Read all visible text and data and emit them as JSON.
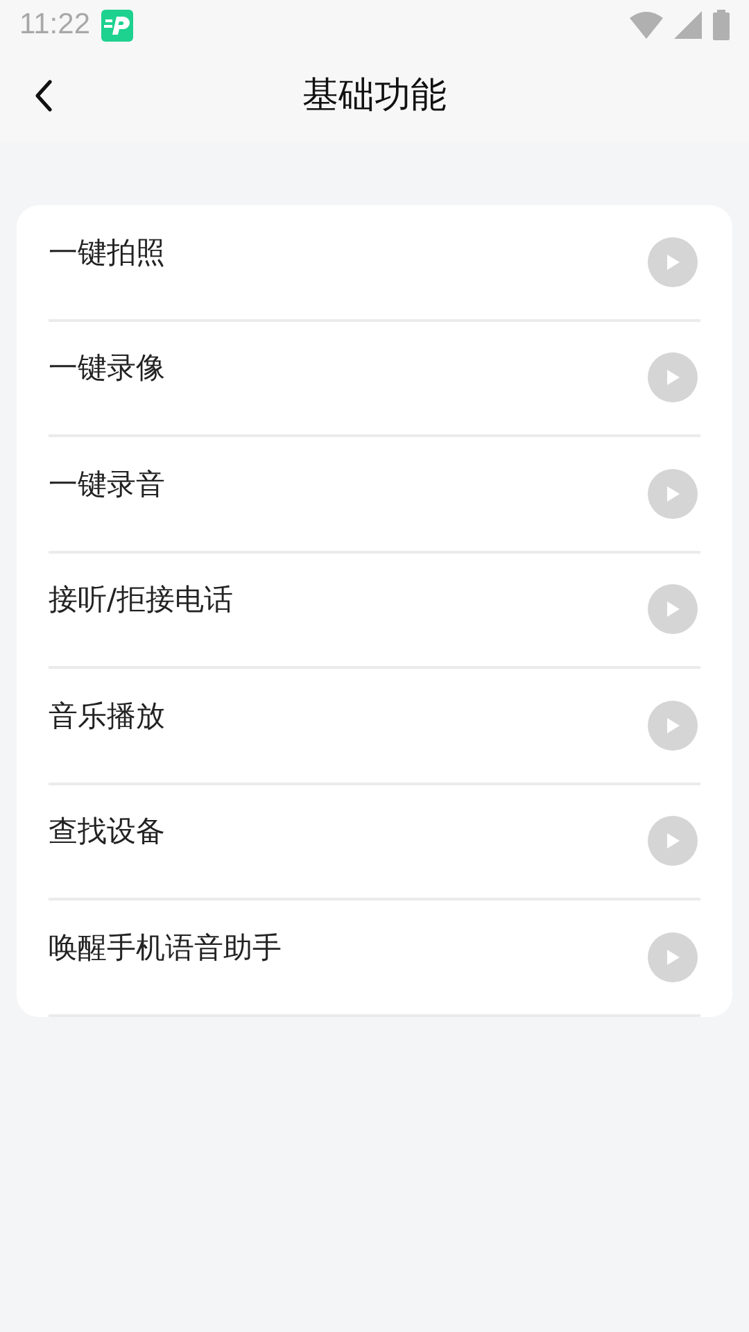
{
  "status_bar": {
    "time": "11:22"
  },
  "header": {
    "title": "基础功能"
  },
  "items": [
    {
      "label": "一键拍照"
    },
    {
      "label": "一键录像"
    },
    {
      "label": "一键录音"
    },
    {
      "label": "接听/拒接电话"
    },
    {
      "label": "音乐播放"
    },
    {
      "label": "查找设备"
    },
    {
      "label": "唤醒手机语音助手"
    }
  ]
}
